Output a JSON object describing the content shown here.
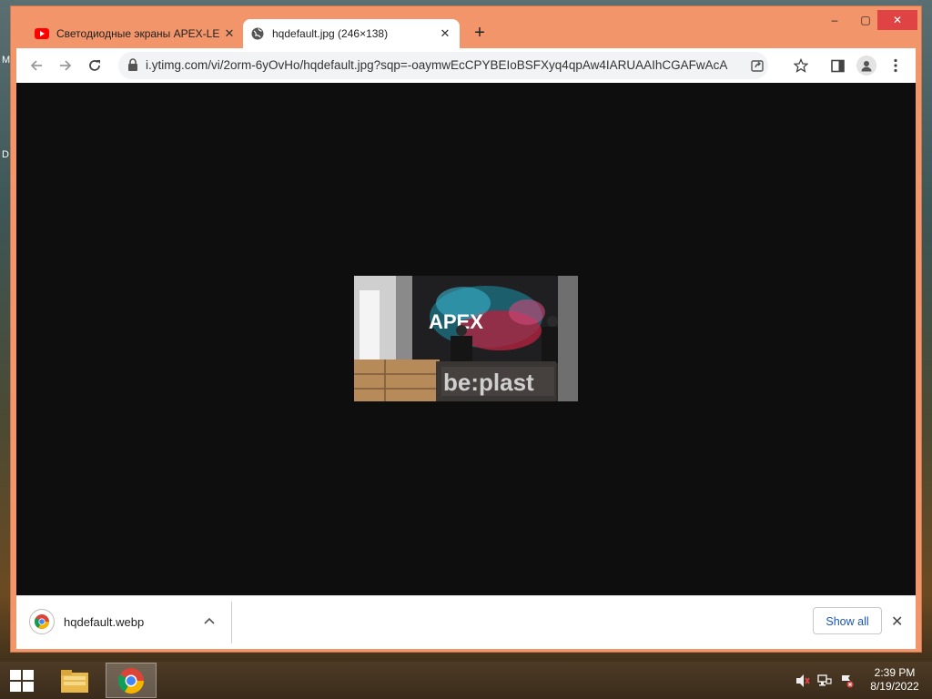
{
  "desktop": {
    "edge_glyphs": [
      "M",
      "D"
    ]
  },
  "window": {
    "tabs": [
      {
        "title": "Светодиодные экраны APEX-LE",
        "icon": "youtube-icon",
        "active": false
      },
      {
        "title": "hqdefault.jpg (246×138)",
        "icon": "globe-icon",
        "active": true
      }
    ],
    "new_tab": "+",
    "controls": {
      "minimize": "–",
      "maximize": "▢",
      "close": "✕"
    }
  },
  "toolbar": {
    "url": "i.ytimg.com/vi/2orm-6yOvHo/hqdefault.jpg?sqp=-oaymwEcCPYBEIoBSFXyq4qpAw4IARUAAIhCGAFwAcAB..."
  },
  "viewport": {
    "image": {
      "background": "#0e0e0e",
      "logo_text": "APEX",
      "sign_text": "be:plast"
    }
  },
  "download_bar": {
    "file_name": "hqdefault.webp",
    "show_all_label": "Show all"
  },
  "taskbar": {
    "time": "2:39 PM",
    "date": "8/19/2022"
  },
  "colors": {
    "window_frame": "#f2956a",
    "close_button": "#e04343",
    "link_blue": "#1a55b8"
  }
}
